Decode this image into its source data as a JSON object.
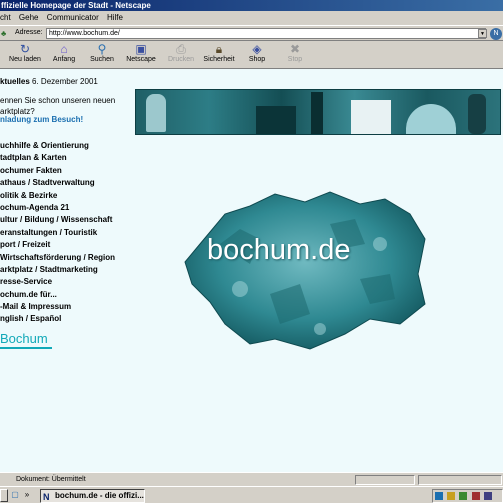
{
  "window": {
    "title": "ffizielle Homepage der Stadt - Netscape"
  },
  "menu": [
    "cht",
    "Gehe",
    "Communicator",
    "Hilfe"
  ],
  "address": {
    "label": "Adresse:",
    "value": "http://www.bochum.de/"
  },
  "toolbar": [
    {
      "label": "Neu laden",
      "icon": "reload-icon",
      "enabled": true
    },
    {
      "label": "Anfang",
      "icon": "home-icon",
      "enabled": true
    },
    {
      "label": "Suchen",
      "icon": "search-icon",
      "enabled": true
    },
    {
      "label": "Netscape",
      "icon": "netscape-icon",
      "enabled": true
    },
    {
      "label": "Drucken",
      "icon": "print-icon",
      "enabled": false
    },
    {
      "label": "Sicherheit",
      "icon": "lock-icon",
      "enabled": true
    },
    {
      "label": "Shop",
      "icon": "shop-icon",
      "enabled": true
    },
    {
      "label": "Stop",
      "icon": "stop-icon",
      "enabled": false
    }
  ],
  "page": {
    "date_prefix": "ktuelles",
    "date": "6. Dezember 2001",
    "teaser": "ennen Sie schon unseren neuen arktplatz?",
    "invite": "nladung zum Besuch!",
    "nav": [
      "uchhilfe & Orientierung",
      "tadtplan & Karten",
      "ochumer Fakten",
      "athaus / Stadtverwaltung",
      "olitik & Bezirke",
      "ochum-Agenda 21",
      "ultur / Bildung / Wissenschaft",
      "eranstaltungen / Touristik",
      "port / Freizeit",
      "Wirtschaftsförderung / Region",
      "arktplatz / Stadtmarketing",
      "resse-Service",
      "ochum.de für...",
      "-Mail & Impressum",
      "nglish / Español"
    ],
    "logo_text": "Bochum",
    "map_title": "bochum.de"
  },
  "status": {
    "text": "Dokument: Übermittelt"
  },
  "taskbar": {
    "task_label": "bochum.de - die offizi..."
  },
  "colors": {
    "title_bar": "#0a246a",
    "link_blue": "#1b6fb0",
    "logo_teal": "#12a9b8",
    "page_bg": "#eefafc"
  }
}
